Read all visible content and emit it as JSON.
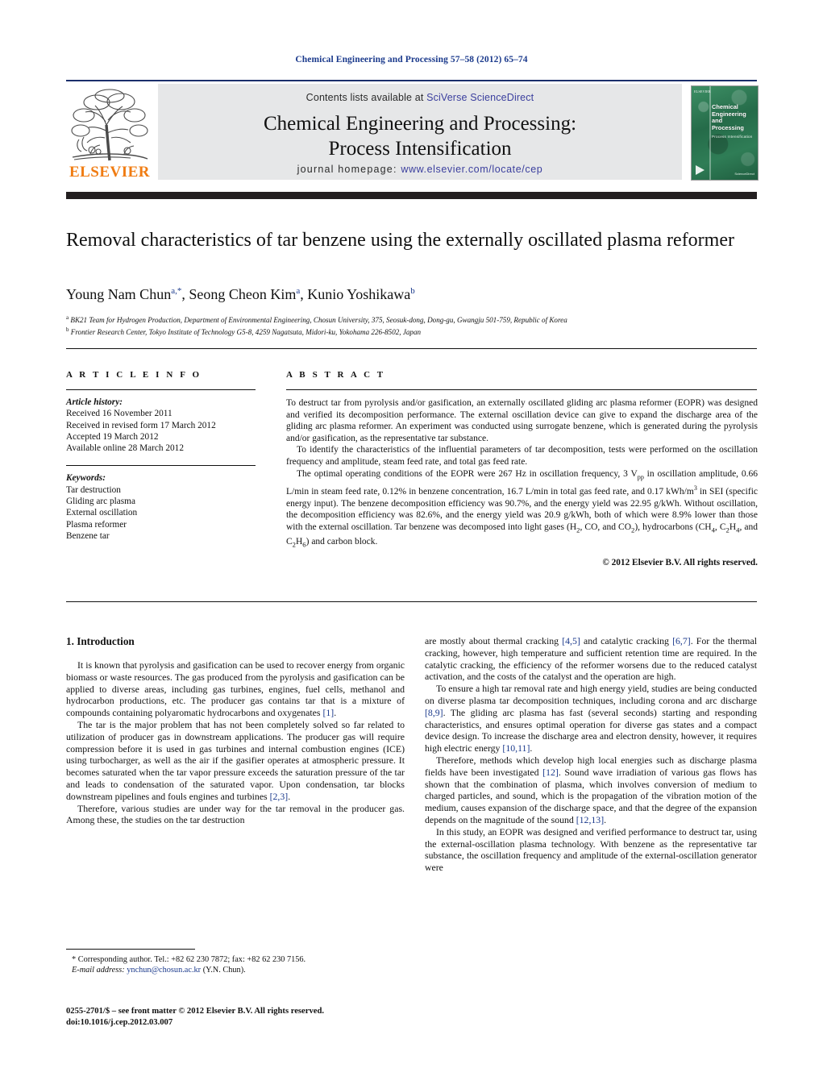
{
  "running_head": "Chemical Engineering and Processing 57–58 (2012) 65–74",
  "header": {
    "contents_prefix": "Contents lists available at ",
    "contents_link": "SciVerse ScienceDirect",
    "journal_title_line1": "Chemical Engineering and Processing:",
    "journal_title_line2": "Process Intensification",
    "homepage_prefix": "journal homepage:",
    "homepage_url": "www.elsevier.com/locate/cep",
    "publisher_logo_text": "ELSEVIER",
    "cover": {
      "title": "Chemical Engineering and Processing",
      "subtitle": "Process Intensification",
      "brand": "ELSEVIER",
      "footer": "ScienceDirect"
    }
  },
  "article": {
    "title": "Removal characteristics of tar benzene using the externally oscillated plasma reformer",
    "authors_html": "Young Nam Chun<sup>a,</sup><sup>*</sup>, Seong Cheon Kim<sup>a</sup>, Kunio Yoshikawa<sup>b</sup>",
    "affiliations": [
      "BK21 Team for Hydrogen Production, Department of Environmental Engineering, Chosun University, 375, Seosuk-dong, Dong-gu, Gwangju 501-759, Republic of Korea",
      "Frontier Research Center, Tokyo Institute of Technology G5-8, 4259 Nagatsuta, Midori-ku, Yokohama 226-8502, Japan"
    ]
  },
  "article_info": {
    "heading": "A R T I C L E   I N F O",
    "history_label": "Article history:",
    "history": [
      "Received 16 November 2011",
      "Received in revised form 17 March 2012",
      "Accepted 19 March 2012",
      "Available online 28 March 2012"
    ],
    "keywords_label": "Keywords:",
    "keywords": [
      "Tar destruction",
      "Gliding arc plasma",
      "External oscillation",
      "Plasma reformer",
      "Benzene tar"
    ]
  },
  "abstract": {
    "heading": "A B S T R A C T",
    "paragraphs": [
      "To destruct tar from pyrolysis and/or gasification, an externally oscillated gliding arc plasma reformer (EOPR) was designed and verified its decomposition performance. The external oscillation device can give to expand the discharge area of the gliding arc plasma reformer. An experiment was conducted using surrogate benzene, which is generated during the pyrolysis and/or gasification, as the representative tar substance.",
      "To identify the characteristics of the influential parameters of tar decomposition, tests were performed on the oscillation frequency and amplitude, steam feed rate, and total gas feed rate.",
      "The optimal operating conditions of the EOPR were 267 Hz in oscillation frequency, 3 Vpp in oscillation amplitude, 0.66 L/min in steam feed rate, 0.12% in benzene concentration, 16.7 L/min in total gas feed rate, and 0.17 kWh/m3 in SEI (specific energy input). The benzene decomposition efficiency was 90.7%, and the energy yield was 22.95 g/kWh. Without oscillation, the decomposition efficiency was 82.6%, and the energy yield was 20.9 g/kWh, both of which were 8.9% lower than those with the external oscillation. Tar benzene was decomposed into light gases (H2, CO, and CO2), hydrocarbons (CH4, C2H4, and C2H6) and carbon block."
    ],
    "copyright": "© 2012 Elsevier B.V. All rights reserved."
  },
  "body": {
    "section_heading": "1.  Introduction",
    "left_paragraphs": [
      "It is known that pyrolysis and gasification can be used to recover energy from organic biomass or waste resources. The gas produced from the pyrolysis and gasification can be applied to diverse areas, including gas turbines, engines, fuel cells, methanol and hydrocarbon productions, etc. The producer gas contains tar that is a mixture of compounds containing polyaromatic hydrocarbons and oxygenates [1].",
      "The tar is the major problem that has not been completely solved so far related to utilization of producer gas in downstream applications. The producer gas will require compression before it is used in gas turbines and internal combustion engines (ICE) using turbocharger, as well as the air if the gasifier operates at atmospheric pressure. It becomes saturated when the tar vapor pressure exceeds the saturation pressure of the tar and leads to condensation of the saturated vapor. Upon condensation, tar blocks downstream pipelines and fouls engines and turbines [2,3].",
      "Therefore, various studies are under way for the tar removal in the producer gas. Among these, the studies on the tar destruction"
    ],
    "right_paragraphs": [
      "are mostly about thermal cracking [4,5] and catalytic cracking [6,7]. For the thermal cracking, however, high temperature and sufficient retention time are required. In the catalytic cracking, the efficiency of the reformer worsens due to the reduced catalyst activation, and the costs of the catalyst and the operation are high.",
      "To ensure a high tar removal rate and high energy yield, studies are being conducted on diverse plasma tar decomposition techniques, including corona and arc discharge [8,9]. The gliding arc plasma has fast (several seconds) starting and responding characteristics, and ensures optimal operation for diverse gas states and a compact device design. To increase the discharge area and electron density, however, it requires high electric energy [10,11].",
      "Therefore, methods which develop high local energies such as discharge plasma fields have been investigated [12]. Sound wave irradiation of various gas flows has shown that the combination of plasma, which involves conversion of medium to charged particles, and sound, which is the propagation of the vibration motion of the medium, causes expansion of the discharge space, and that the degree of the expansion depends on the magnitude of the sound [12,13].",
      "In this study, an EOPR was designed and verified performance to destruct tar, using the external-oscillation plasma technology. With benzene as the representative tar substance, the oscillation frequency and amplitude of the external-oscillation generator were"
    ]
  },
  "footnote": {
    "corresponding": "* Corresponding author. Tel.: +82 62 230 7872; fax: +82 62 230 7156.",
    "email_label": "E-mail address:",
    "email": "ynchun@chosun.ac.kr",
    "email_suffix": "(Y.N. Chun)."
  },
  "imprint": {
    "line1": "0255-2701/$ – see front matter © 2012 Elsevier B.V. All rights reserved.",
    "line2": "doi:10.1016/j.cep.2012.03.007"
  },
  "colors": {
    "link_blue": "#1b3a8c",
    "elsevier_orange": "#f07c12",
    "cover_green": "#2e7a55",
    "rule_navy": "#1b2f6b"
  }
}
